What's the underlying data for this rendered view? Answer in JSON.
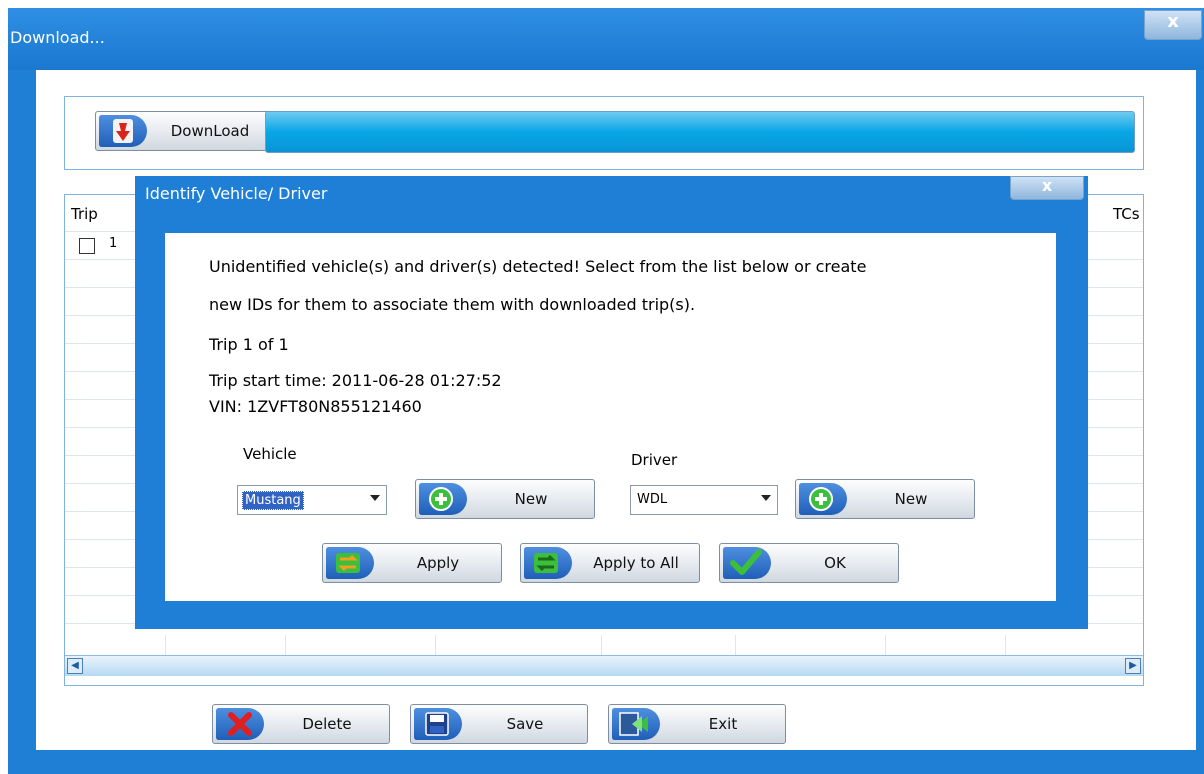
{
  "window": {
    "title": "Download...",
    "close_glyph": "x"
  },
  "download_panel": {
    "download_label": "DownLoad",
    "progress": 1.0
  },
  "table": {
    "headers": {
      "trip": "Trip",
      "dtcs": "TCs"
    },
    "rows": [
      {
        "label": "1",
        "checked": false
      }
    ]
  },
  "bottom_buttons": {
    "delete": "Delete",
    "save": "Save",
    "exit": "Exit"
  },
  "dialog": {
    "title": "Identify Vehicle/ Driver",
    "close_glyph": "x",
    "message_line1": "Unidentified vehicle(s) and driver(s) detected! Select from the list below or create",
    "message_line2": "new IDs for them to associate them with downloaded trip(s).",
    "trip_counter": "Trip 1 of 1",
    "trip_start": "Trip start time:   2011-06-28 01:27:52",
    "vin": "VIN: 1ZVFT80N855121460",
    "vehicle_label": "Vehicle",
    "vehicle_value": "Mustang",
    "driver_label": "Driver",
    "driver_value": "WDL",
    "new_vehicle_label": "New",
    "new_driver_label": "New",
    "apply_label": "Apply",
    "apply_all_label": "Apply to All",
    "ok_label": "OK"
  },
  "colors": {
    "window_blue": "#1e7fd4",
    "progress_cyan": "#08a6e6",
    "icon_green": "#3cbf3c",
    "icon_red": "#e02020"
  }
}
